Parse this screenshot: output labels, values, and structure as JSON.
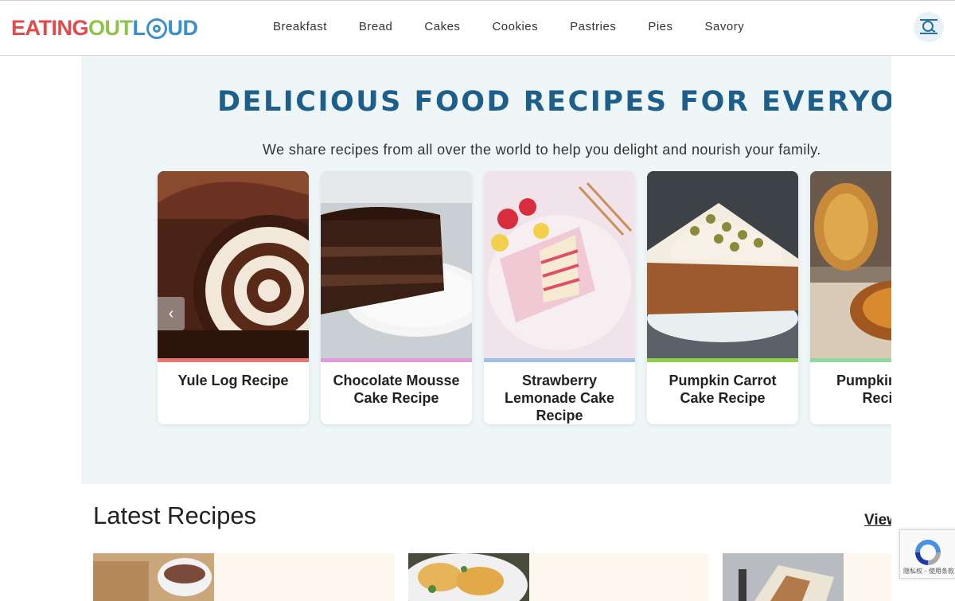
{
  "brand": {
    "logo_parts": [
      "EATING",
      "OUT",
      "L",
      "UD"
    ]
  },
  "nav": {
    "items": [
      "Breakfast",
      "Bread",
      "Cakes",
      "Cookies",
      "Pastries",
      "Pies",
      "Savory"
    ]
  },
  "search": {
    "icon": "search-icon"
  },
  "hero": {
    "title": "DELICIOUS FOOD RECIPES FOR EVERYONE",
    "subtitle": "We share recipes from all over the world to help you delight and nourish your family.",
    "cards": [
      {
        "title": "Yule Log Recipe",
        "accent": "#e8776d"
      },
      {
        "title": "Chocolate Mousse Cake Recipe",
        "accent": "#e39be0"
      },
      {
        "title": "Strawberry Lemonade Cake Recipe",
        "accent": "#9bbfe6"
      },
      {
        "title": "Pumpkin Carrot Cake Recipe",
        "accent": "#8fcf4a"
      },
      {
        "title": "Pumpkin Cake Recipe",
        "accent": "#8ed9a0"
      }
    ],
    "prev_icon": "chevron-left-icon"
  },
  "latest": {
    "title": "Latest Recipes",
    "view_all": "View All"
  },
  "recaptcha": {
    "footer": "隐私权 - 使用条款"
  },
  "colors": {
    "brand_red": "#e04a4a",
    "brand_green": "#8cc44a",
    "brand_blue": "#3a8fd0",
    "hero_title": "#1d5f8a",
    "hero_bg": "#eef6f8"
  }
}
